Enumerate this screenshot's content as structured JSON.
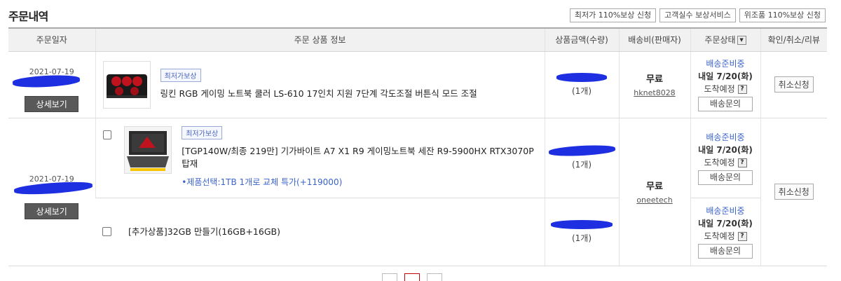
{
  "header": {
    "title": "주문내역",
    "buttons": [
      "최저가 110%보상 신청",
      "고객실수 보상서비스",
      "위조품 110%보상 신청"
    ]
  },
  "table": {
    "columns": [
      "주문일자",
      "주문 상품 정보",
      "상품금액(수량)",
      "배송비(판매자)",
      "주문상태",
      "확인/취소/리뷰"
    ]
  },
  "orders": [
    {
      "date": "2021-07-19",
      "detail_label": "상세보기",
      "seller": "hknet8028",
      "shipping": "무료",
      "cancel_label": "취소신청",
      "items": [
        {
          "badge": "최저가보상",
          "name": "링킨 RGB 게이밍 노트북 쿨러 LS-610 17인치 지원 7단계 각도조절 버튼식 모드 조절",
          "qty": "(1개)",
          "status": "배송준비중",
          "eta": "내일 7/20(화)",
          "arrive": "도착예정",
          "inquiry": "배송문의"
        }
      ]
    },
    {
      "date": "2021-07-19",
      "detail_label": "상세보기",
      "seller": "oneetech",
      "shipping": "무료",
      "cancel_label": "취소신청",
      "items": [
        {
          "badge": "최저가보상",
          "name": "[TGP140W/최종 219만] 기가바이트 A7 X1 R9 게이밍노트북 세잔 R9-5900HX RTX3070P 탑재",
          "option": "•제품선택:1TB 1개로 교체 특가(+119000)",
          "qty": "(1개)",
          "status": "배송준비중",
          "eta": "내일 7/20(화)",
          "arrive": "도착예정",
          "inquiry": "배송문의"
        },
        {
          "name": "[추가상품]32GB 만들기(16GB+16GB)",
          "qty": "(1개)",
          "status": "배송준비중",
          "eta": "내일 7/20(화)",
          "arrive": "도착예정",
          "inquiry": "배송문의"
        }
      ]
    }
  ],
  "colors": {
    "accent_blue": "#3b63c9",
    "redaction": "#1d2fe0",
    "detail_button": "#595959"
  }
}
